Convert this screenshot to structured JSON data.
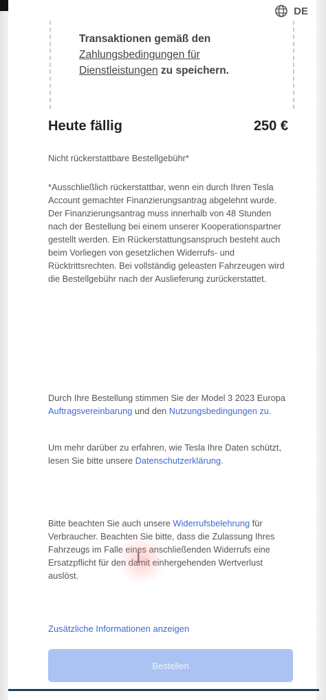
{
  "header": {
    "language_code": "DE",
    "language_icon": "globe-icon"
  },
  "terms_box": {
    "line1": "Transaktionen gemäß den",
    "link_text": "Zahlungsbedingungen für Dienstleistungen",
    "line_end": "zu speichern."
  },
  "due": {
    "label": "Heute fällig",
    "amount": "250 €"
  },
  "fee_label": "Nicht rückerstattbare Bestellgebühr*",
  "refund_note": "*Ausschließlich rückerstattbar, wenn ein durch Ihren Tesla Account gemachter Finanzierungsantrag abgelehnt wurde. Der Finanzierungsantrag muss innerhalb von 48 Stunden nach der Bestellung bei einem unserer Kooperationspartner gestellt werden. Ein Rückerstattungsanspruch besteht auch beim Vorliegen von gesetzlichen Widerrufs- und Rücktrittsrechten. Bei vollständig geleasten Fahrzeugen wird die Bestellgebühr nach der Auslieferung zurückerstattet.",
  "agreement": {
    "prefix": "Durch Ihre Bestellung stimmen Sie der Model 3 2023 Europa ",
    "link1": "Auftragsvereinbarung",
    "middle": " und den ",
    "link2": "Nutzungsbedingungen zu."
  },
  "privacy": {
    "prefix": "Um mehr darüber zu erfahren, wie Tesla Ihre Daten schützt, lesen Sie bitte unsere ",
    "link": "Datenschutzerklärung."
  },
  "withdrawal": {
    "prefix": "Bitte beachten Sie auch unsere ",
    "link": "Widerrufsbelehrung",
    "suffix": " für Verbraucher. Beachten Sie bitte, dass die Zulassung Ihres Fahrzeugs im Falle eines anschließenden Widerrufs eine Ersatzpflicht für den damit einhergehenden Wertverlust auslöst."
  },
  "more_info_link": "Zusätzliche Informationen anzeigen",
  "order_button": "Bestellen"
}
